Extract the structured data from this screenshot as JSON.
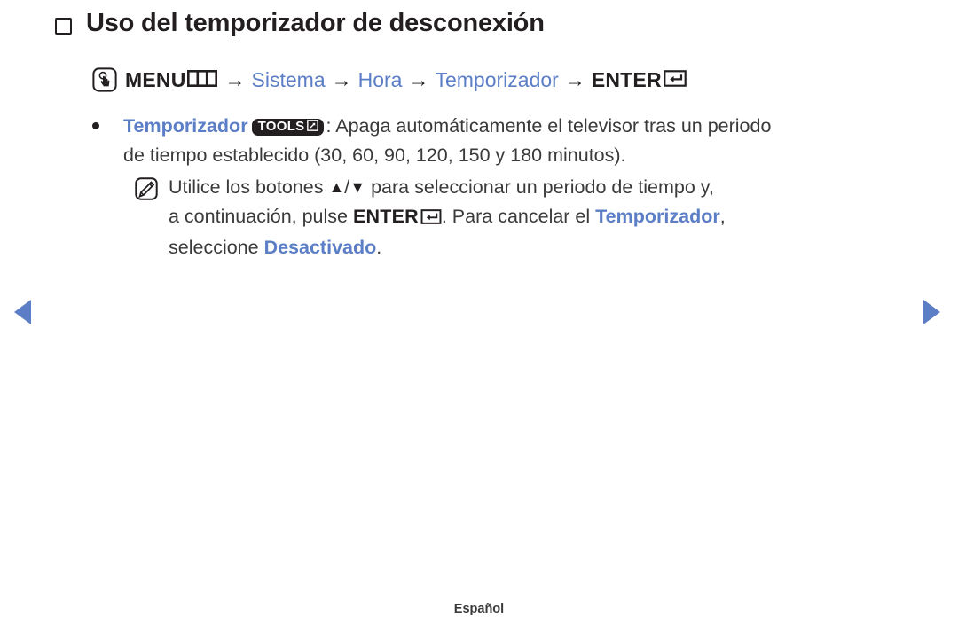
{
  "page": {
    "title": "Uso del temporizador de desconexión",
    "language_footer": "Español",
    "accent_color": "#5b7ec6",
    "text_color": "#3a3a3a"
  },
  "menu_path": {
    "icon": "press-button-icon",
    "menu_label": "MENU",
    "menu_glyph": "menu-bars-icon",
    "separator": "→",
    "steps": [
      {
        "label": "Sistema",
        "style": "accent"
      },
      {
        "label": "Hora",
        "style": "accent"
      },
      {
        "label": "Temporizador",
        "style": "accent"
      }
    ],
    "enter_label": "ENTER",
    "enter_glyph": "enter-return-icon"
  },
  "bullet": {
    "marker": "•",
    "term": "Temporizador",
    "badge": {
      "label": "TOOLS",
      "glyph": "tools-arrow-icon"
    },
    "text_after_badge": ": Apaga automáticamente el televisor tras un periodo",
    "line2": "de tiempo establecido (30, 60, 90, 120, 150 y 180 minutos)."
  },
  "note": {
    "icon": "note-pencil-icon",
    "part1": "Utilice los botones ",
    "arrow_up": "▲",
    "slash": "/",
    "arrow_down": "▼",
    "part2": " para seleccionar un periodo de tiempo y,",
    "part3": "a continuación, pulse ",
    "enter_label": "ENTER",
    "enter_glyph": "enter-return-icon",
    "part4": ". Para cancelar el ",
    "term_cancel": "Temporizador",
    "part5": ",",
    "part6": "seleccione ",
    "term_off": "Desactivado",
    "part7": "."
  },
  "navigation": {
    "prev_icon": "triangle-left-icon",
    "next_icon": "triangle-right-icon"
  }
}
